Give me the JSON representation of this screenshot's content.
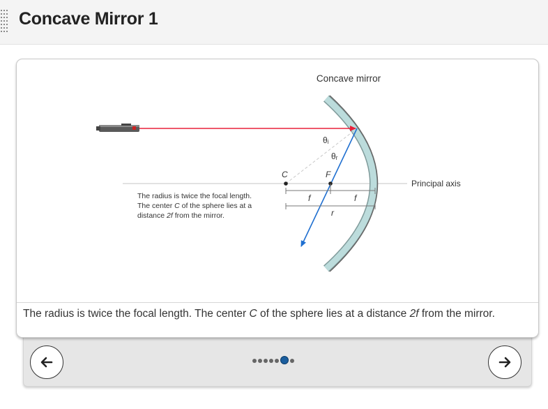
{
  "header": {
    "title": "Concave Mirror 1"
  },
  "figure": {
    "mirror_label": "Concave mirror",
    "axis_label": "Principal axis",
    "center_label": "C",
    "focal_label": "F",
    "theta_i": "θᵢ",
    "theta_r": "θᵣ",
    "f_label_1": "f",
    "f_label_2": "f",
    "r_label": "r",
    "note_line1": "The radius is twice the focal length.",
    "note_line2": "The center C of the sphere lies at a",
    "note_line3": "distance 2f from the mirror.",
    "colors": {
      "laser_beam": "#e8203a",
      "reflected_ray": "#1f6fd0",
      "mirror": "#bcdcdc",
      "mirror_edge": "#666666"
    }
  },
  "caption": {
    "part1": "The radius is twice the focal length. The center ",
    "c": "C",
    "part2": " of the sphere lies at a distance ",
    "twof": "2f",
    "part3": " from the mirror."
  },
  "nav": {
    "prev_icon": "arrow-left-icon",
    "next_icon": "arrow-right-icon",
    "total_steps": 7,
    "current_step": 6
  }
}
